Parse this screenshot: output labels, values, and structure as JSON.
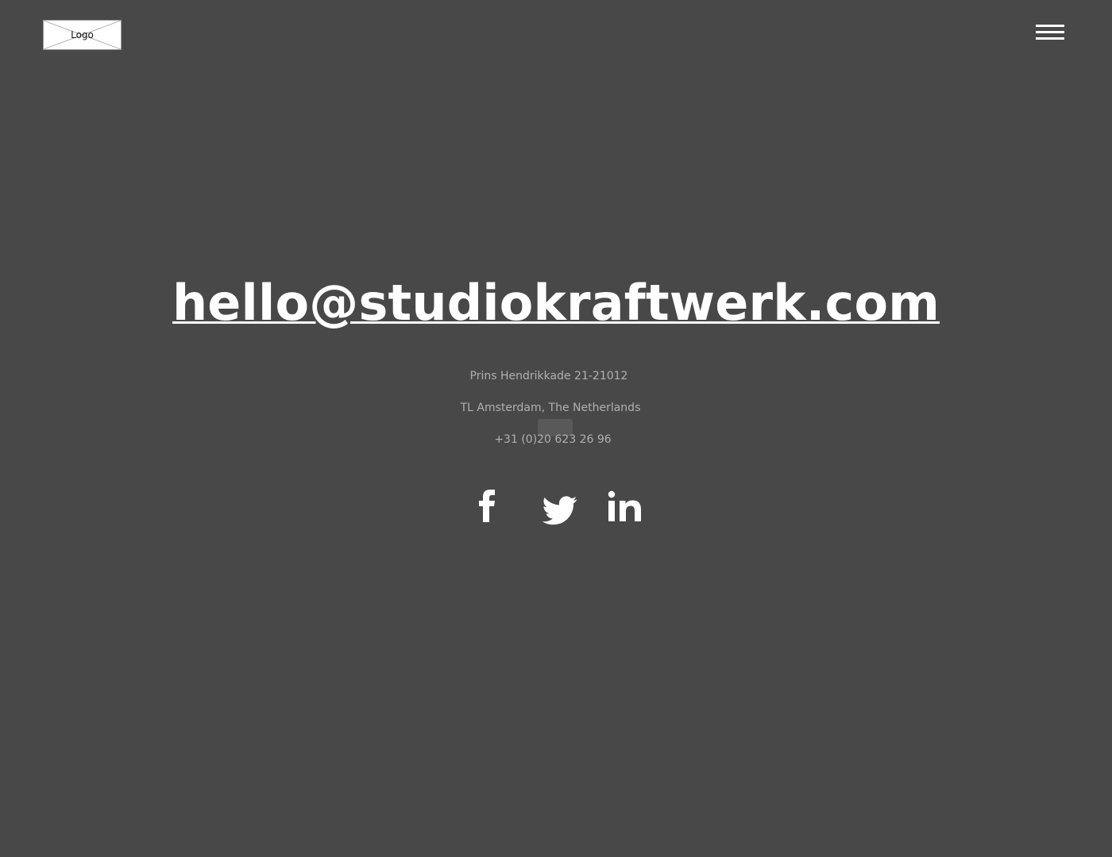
{
  "header": {
    "logo_label": "Logo"
  },
  "contact": {
    "email": "hello@studiokraftwerk.com",
    "address_line_1": "Prins Hendrikkade 21-21012",
    "address_line_2": "TL Amsterdam, The Netherlands",
    "phone": "+31 (0)20 623 26 96"
  },
  "social": [
    {
      "name": "facebook",
      "icon": "facebook-icon"
    },
    {
      "name": "twitter",
      "icon": "twitter-icon"
    },
    {
      "name": "linkedin",
      "icon": "linkedin-icon"
    }
  ],
  "colors": {
    "background": "#484848",
    "text_primary": "#ffffff",
    "text_secondary": "#b0b0b0"
  }
}
